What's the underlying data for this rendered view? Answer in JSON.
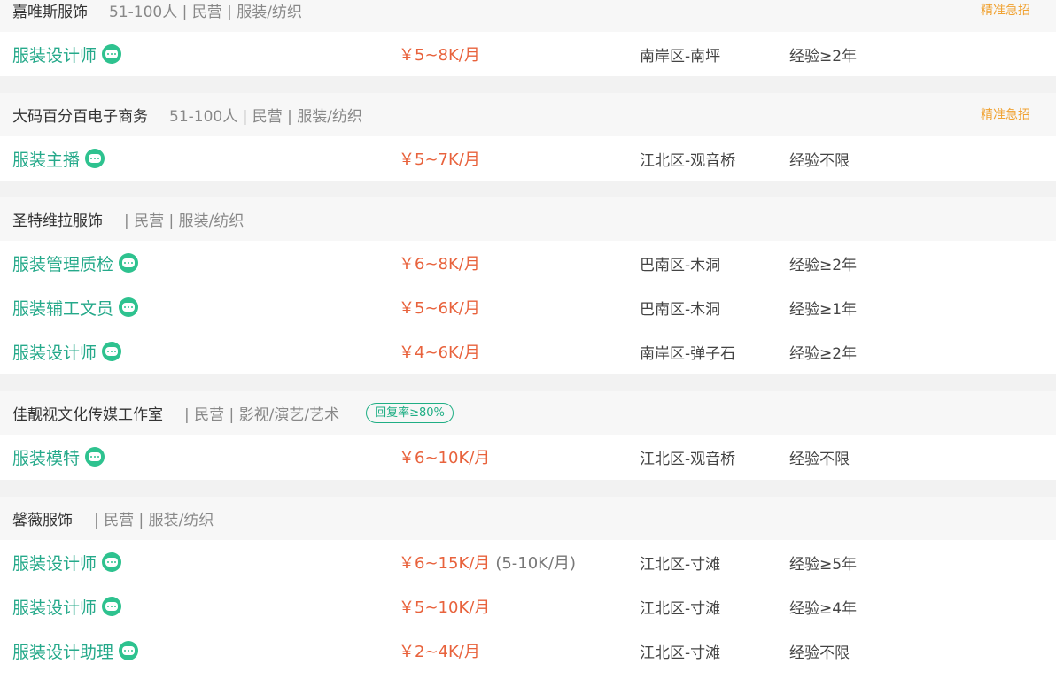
{
  "companies": [
    {
      "name": "嘉唯斯服饰",
      "meta": "51-100人 | 民营 | 服装/纺织",
      "tag": "精准急招",
      "jobs": [
        {
          "title": "服装设计师",
          "salary": "￥5~8K/月",
          "note": "",
          "location": "南岸区-南坪",
          "experience": "经验≥2年"
        }
      ]
    },
    {
      "name": "大码百分百电子商务",
      "meta": "51-100人 | 民营 | 服装/纺织",
      "tag": "精准急招",
      "jobs": [
        {
          "title": "服装主播",
          "salary": "￥5~7K/月",
          "note": "",
          "location": "江北区-观音桥",
          "experience": "经验不限"
        }
      ]
    },
    {
      "name": "圣特维拉服饰",
      "meta": "| 民营 | 服装/纺织",
      "tag": "",
      "jobs": [
        {
          "title": "服装管理质检",
          "salary": "￥6~8K/月",
          "note": "",
          "location": "巴南区-木洞",
          "experience": "经验≥2年"
        },
        {
          "title": "服装辅工文员",
          "salary": "￥5~6K/月",
          "note": "",
          "location": "巴南区-木洞",
          "experience": "经验≥1年"
        },
        {
          "title": "服装设计师",
          "salary": "￥4~6K/月",
          "note": "",
          "location": "南岸区-弹子石",
          "experience": "经验≥2年"
        }
      ]
    },
    {
      "name": "佳靓视文化传媒工作室",
      "meta": "| 民营 | 影视/演艺/艺术",
      "badge": "回复率≥80%",
      "tag": "",
      "jobs": [
        {
          "title": "服装模特",
          "salary": "￥6~10K/月",
          "note": "",
          "location": "江北区-观音桥",
          "experience": "经验不限"
        }
      ]
    },
    {
      "name": "馨薇服饰",
      "meta": "| 民营 | 服装/纺织",
      "tag": "",
      "jobs": [
        {
          "title": "服装设计师",
          "salary": "￥6~15K/月",
          "note": "(5-10K/月)",
          "location": "江北区-寸滩",
          "experience": "经验≥5年"
        },
        {
          "title": "服装设计师",
          "salary": "￥5~10K/月",
          "note": "",
          "location": "江北区-寸滩",
          "experience": "经验≥4年"
        },
        {
          "title": "服装设计助理",
          "salary": "￥2~4K/月",
          "note": "",
          "location": "江北区-寸滩",
          "experience": "经验不限"
        }
      ]
    }
  ]
}
